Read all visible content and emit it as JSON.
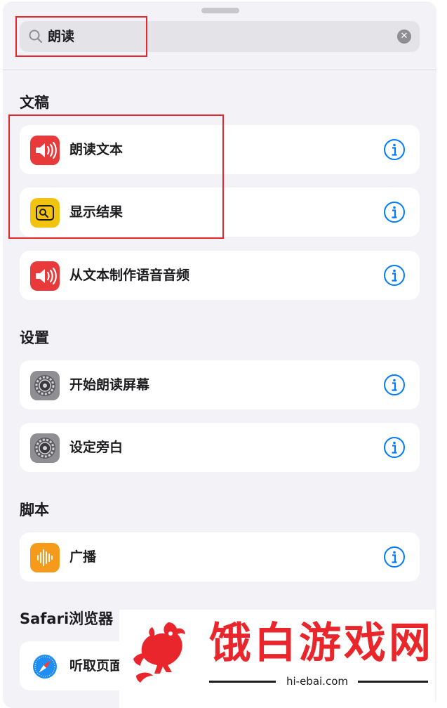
{
  "search": {
    "query": "朗读"
  },
  "sections": [
    {
      "title": "文稿",
      "items": [
        {
          "label": "朗读文本",
          "icon": "speaker-icon"
        },
        {
          "label": "显示结果",
          "icon": "quicklook-icon"
        },
        {
          "label": "从文本制作语音音频",
          "icon": "speaker-icon"
        }
      ]
    },
    {
      "title": "设置",
      "items": [
        {
          "label": "开始朗读屏幕",
          "icon": "settings-gear-icon"
        },
        {
          "label": "设定旁白",
          "icon": "settings-gear-icon"
        }
      ]
    },
    {
      "title": "脚本",
      "items": [
        {
          "label": "广播",
          "icon": "waveform-icon"
        }
      ]
    },
    {
      "title": "Safari浏览器",
      "items": [
        {
          "label": "听取页面",
          "icon": "safari-compass-icon"
        }
      ]
    }
  ],
  "watermark": {
    "title": "饿白游戏网",
    "url": "hi-ebai.com"
  },
  "colors": {
    "accent": "#007aff",
    "highlight": "#e8262b",
    "speaker": "#e8393b",
    "quicklook": "#f2c40f",
    "waveform": "#f59a1b"
  }
}
